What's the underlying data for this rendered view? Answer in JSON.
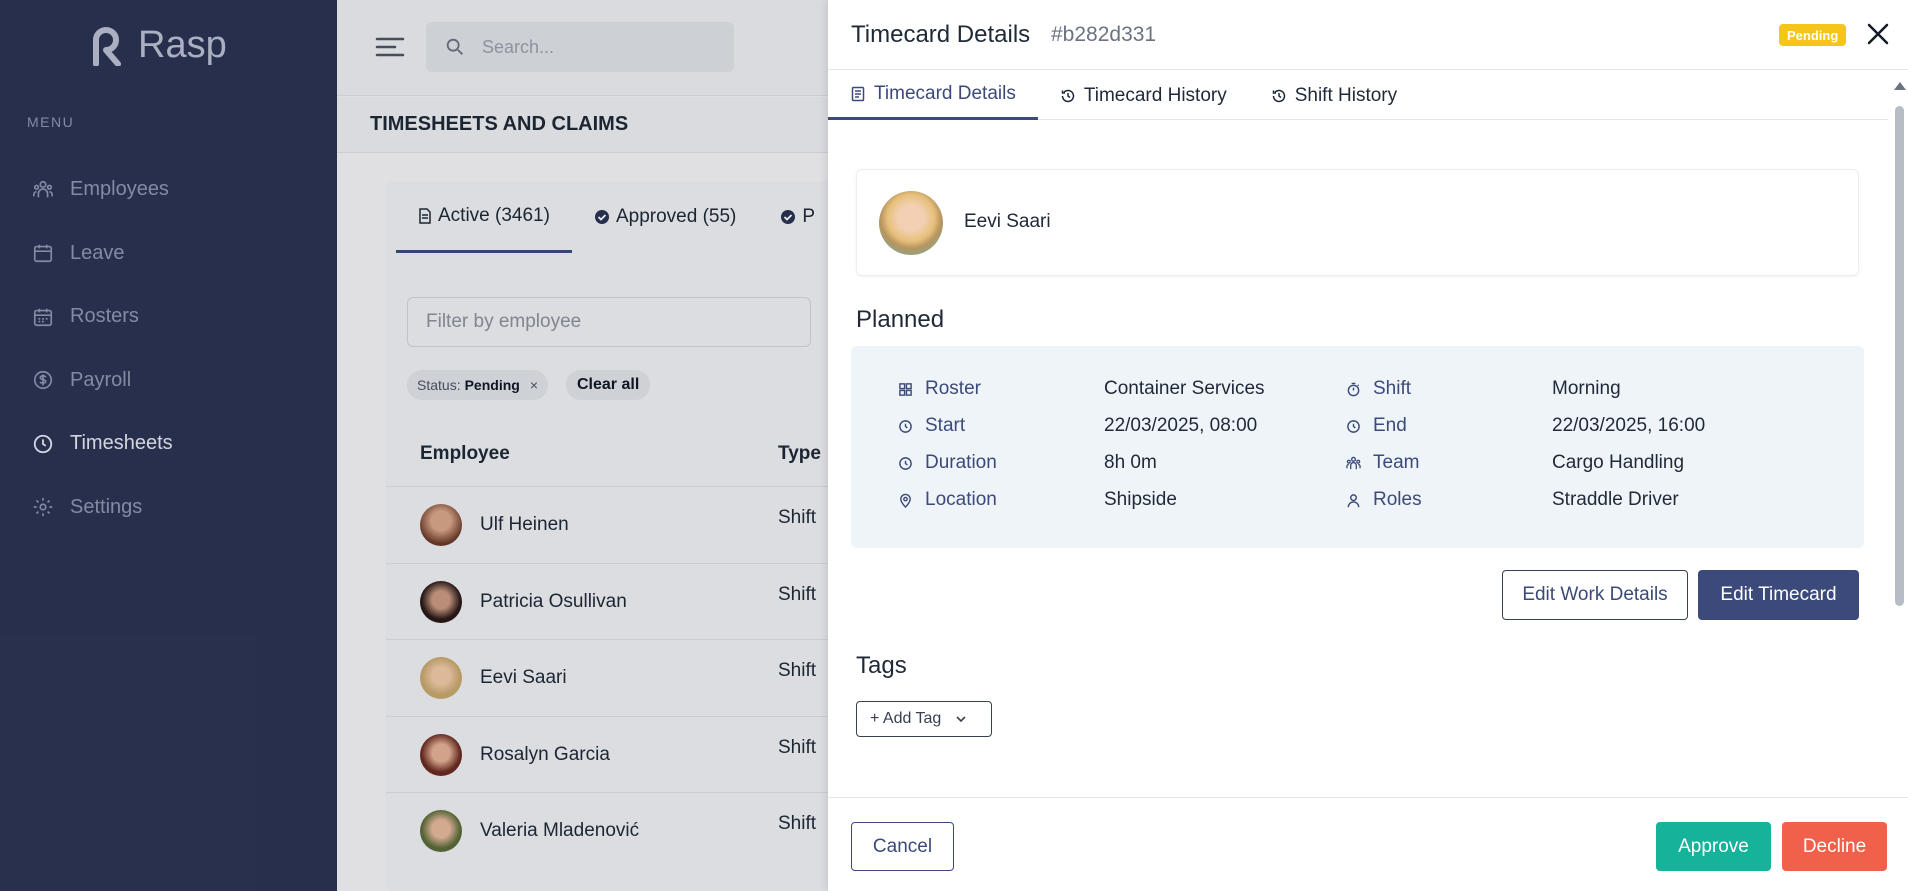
{
  "app": {
    "name": "Rasp"
  },
  "sidebar": {
    "menu_label": "MENU",
    "items": [
      {
        "label": "Employees",
        "icon": "people-icon"
      },
      {
        "label": "Leave",
        "icon": "calendar-icon"
      },
      {
        "label": "Rosters",
        "icon": "calendar-grid-icon"
      },
      {
        "label": "Payroll",
        "icon": "dollar-circle-icon"
      },
      {
        "label": "Timesheets",
        "icon": "clock-icon",
        "active": true
      },
      {
        "label": "Settings",
        "icon": "gear-icon"
      }
    ]
  },
  "topbar": {
    "search_placeholder": "Search..."
  },
  "page": {
    "title": "TIMESHEETS AND CLAIMS"
  },
  "list": {
    "tabs": [
      {
        "label": "Active (3461)"
      },
      {
        "label": "Approved (55)"
      },
      {
        "label": "P"
      }
    ],
    "filter_placeholder": "Filter by employee",
    "chip": {
      "key": "Status:",
      "value": "Pending",
      "remove": "×"
    },
    "clear_all": "Clear all",
    "columns": {
      "employee": "Employee",
      "type": "Type"
    },
    "rows": [
      {
        "name": "Ulf Heinen",
        "type": "Shift"
      },
      {
        "name": "Patricia Osullivan",
        "type": "Shift"
      },
      {
        "name": "Eevi Saari",
        "type": "Shift"
      },
      {
        "name": "Rosalyn Garcia",
        "type": "Shift"
      },
      {
        "name": "Valeria Mladenović",
        "type": "Shift"
      }
    ]
  },
  "drawer": {
    "title": "Timecard Details",
    "id": "#b282d331",
    "status": "Pending",
    "tabs": [
      {
        "label": "Timecard Details",
        "icon": "document-icon"
      },
      {
        "label": "Timecard History",
        "icon": "history-icon"
      },
      {
        "label": "Shift History",
        "icon": "history-icon"
      }
    ],
    "employee": {
      "name": "Eevi Saari"
    },
    "planned": {
      "title": "Planned",
      "left": [
        {
          "label": "Roster",
          "value": "Container Services",
          "icon": "grid-icon"
        },
        {
          "label": "Start",
          "value": "22/03/2025, 08:00",
          "icon": "clock-icon"
        },
        {
          "label": "Duration",
          "value": "8h 0m",
          "icon": "clock-icon"
        },
        {
          "label": "Location",
          "value": "Shipside",
          "icon": "location-pin-icon"
        }
      ],
      "right": [
        {
          "label": "Shift",
          "value": "Morning",
          "icon": "stopwatch-icon"
        },
        {
          "label": "End",
          "value": "22/03/2025, 16:00",
          "icon": "clock-icon"
        },
        {
          "label": "Team",
          "value": "Cargo Handling",
          "icon": "team-icon"
        },
        {
          "label": "Roles",
          "value": "Straddle Driver",
          "icon": "person-icon"
        }
      ]
    },
    "buttons": {
      "edit_work": "Edit Work Details",
      "edit_timecard": "Edit Timecard"
    },
    "tags": {
      "title": "Tags",
      "add": "+ Add Tag"
    },
    "footer": {
      "cancel": "Cancel",
      "approve": "Approve",
      "decline": "Decline"
    }
  },
  "colors": {
    "sidebar": "#2b3454",
    "accent": "#3b4a7a",
    "approve": "#14b39a",
    "decline": "#f0604a",
    "pending": "#f5c518"
  }
}
